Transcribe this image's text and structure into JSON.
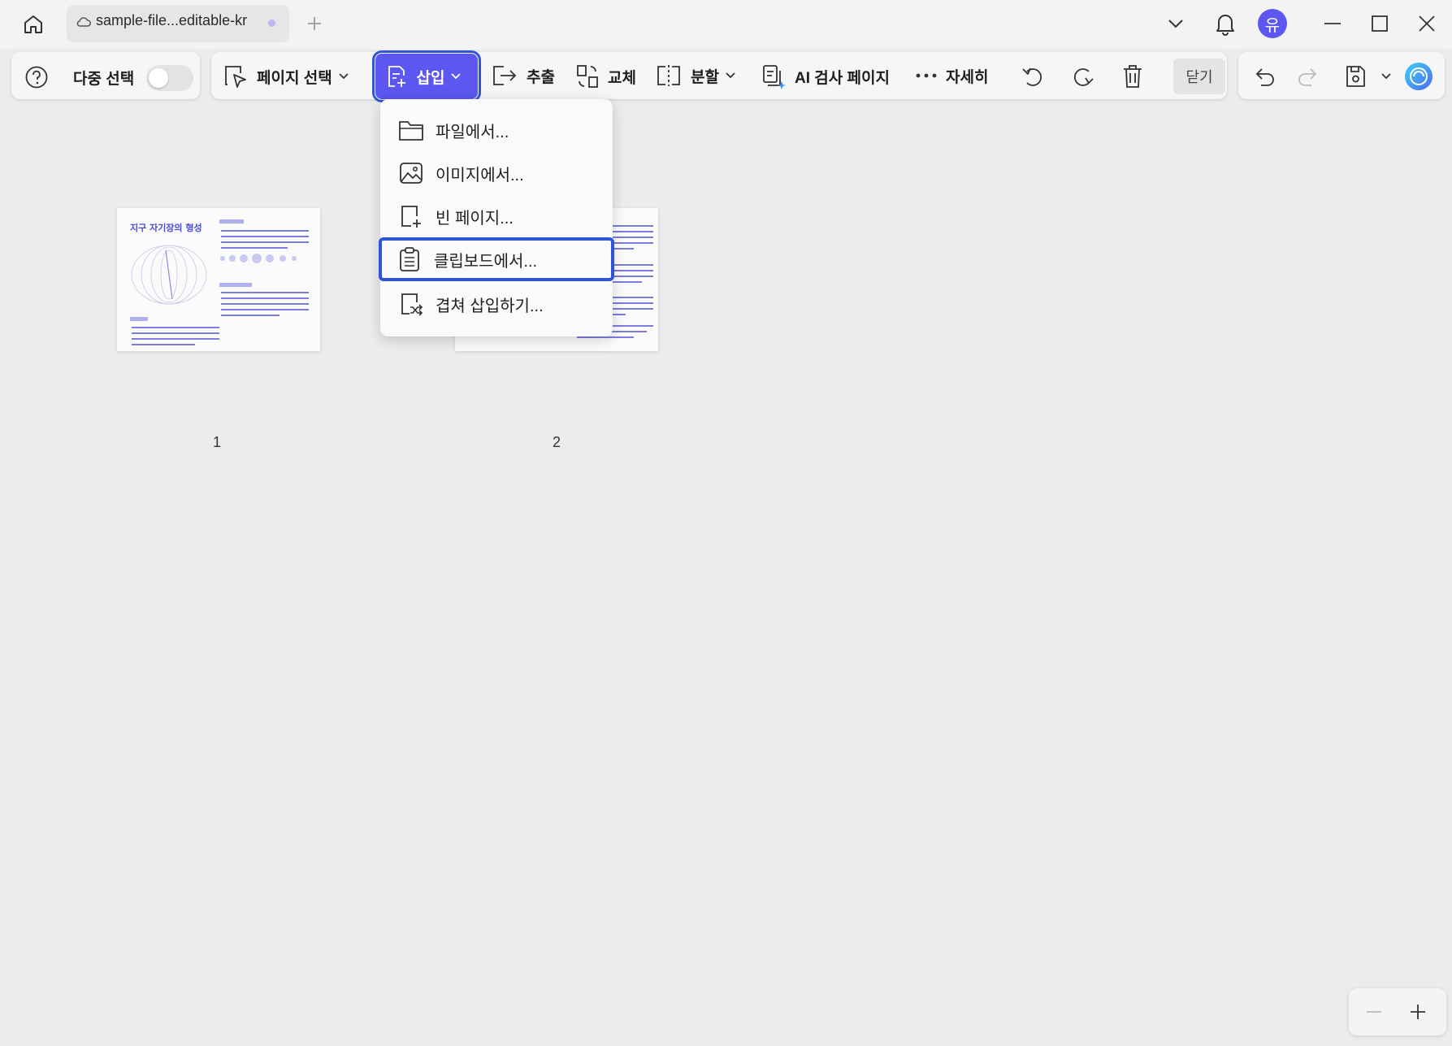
{
  "tab": {
    "title": "sample-file...editable-kr"
  },
  "user": {
    "avatar_initial": "유"
  },
  "toolbar": {
    "multi_select_label": "다중 선택",
    "multi_select_on": false,
    "page_select_label": "페이지 선택",
    "insert_label": "삽입",
    "extract_label": "추출",
    "replace_label": "교체",
    "split_label": "분할",
    "ai_check_label": "AI 검사 페이지",
    "more_label": "자세히",
    "close_label": "닫기"
  },
  "insert_menu": {
    "items": [
      {
        "label": "파일에서...",
        "icon": "folder-icon"
      },
      {
        "label": "이미지에서...",
        "icon": "image-icon"
      },
      {
        "label": "빈 페이지...",
        "icon": "blank-page-icon"
      },
      {
        "label": "클립보드에서...",
        "icon": "clipboard-icon",
        "highlighted": true
      },
      {
        "label": "겹쳐 삽입하기...",
        "icon": "interleave-icon"
      }
    ]
  },
  "pages": [
    {
      "number": "1",
      "heading": "지구 자기장의 형성"
    },
    {
      "number": "2"
    }
  ],
  "colors": {
    "accent": "#5b57f0",
    "focus_outline": "#2e55d6",
    "thumb_text": "#4b4bd8"
  }
}
